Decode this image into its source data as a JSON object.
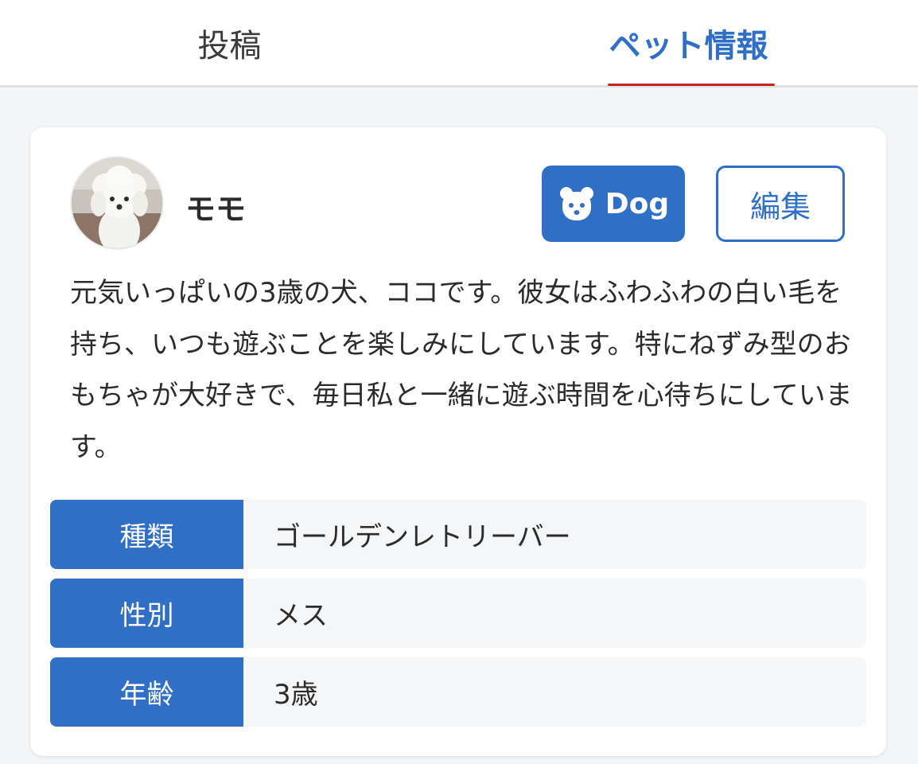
{
  "tabs": {
    "posts_label": "投稿",
    "pet_info_label": "ペット情報",
    "active": "ペット情報"
  },
  "pet": {
    "name": "モモ",
    "species_badge": {
      "label": "Dog",
      "icon": "dog-face-icon"
    },
    "edit_label": "編集",
    "description": "元気いっぱいの3歳の犬、ココです。彼女はふわふわの白い毛を持ち、いつも遊ぶことを楽しみにしています。特にねずみ型のおもちゃが大好きで、毎日私と一緒に遊ぶ時間を心待ちにしています。",
    "info": [
      {
        "label": "種類",
        "value": "ゴールデンレトリーバー"
      },
      {
        "label": "性別",
        "value": "メス"
      },
      {
        "label": "年齢",
        "value": "3歳"
      }
    ]
  },
  "colors": {
    "accent": "#2f6fc5",
    "tab_underline": "#c22626",
    "background": "#f4f5f7",
    "row_value_bg": "#f5f6f8"
  }
}
